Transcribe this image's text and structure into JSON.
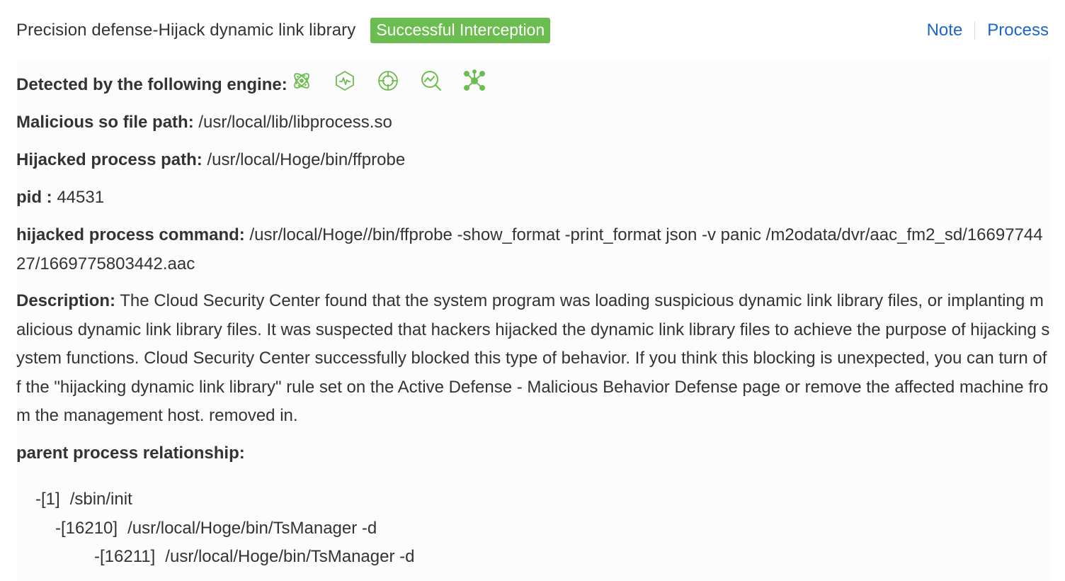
{
  "header": {
    "title": "Precision defense-Hijack dynamic link library",
    "status_badge": "Successful Interception",
    "status_color": "#6bbd4f",
    "actions": {
      "note": "Note",
      "process": "Process"
    }
  },
  "details": {
    "engine_label": "Detected by the following engine:",
    "engine_icons": [
      "atom-engine-icon",
      "hexagon-pulse-engine-icon",
      "crosshair-engine-icon",
      "magnify-trend-engine-icon",
      "network-engine-icon"
    ],
    "malicious_so_label": "Malicious so file path:",
    "malicious_so_value": "/usr/local/lib/libprocess.so",
    "hijacked_path_label": "Hijacked process path:",
    "hijacked_path_value": "/usr/local/Hoge/bin/ffprobe",
    "pid_label": "pid :",
    "pid_value": "44531",
    "command_label": "hijacked process command:",
    "command_value": "/usr/local/Hoge//bin/ffprobe -show_format -print_format json -v panic /m2odata/dvr/aac_fm2_sd/1669774427/1669775803442.aac",
    "description_label": "Description:",
    "description_value": "The Cloud Security Center found that the system program was loading suspicious dynamic link library files, or implanting malicious dynamic link library files. It was suspected that hackers hijacked the dynamic link library files to achieve the purpose of hijacking system functions. Cloud Security Center successfully blocked this type of behavior. If you think this blocking is unexpected, you can turn off the \"hijacking dynamic link library\" rule set on the Active Defense - Malicious Behavior Defense page or remove the affected machine from the management host. removed in.",
    "parent_label": "parent process relationship:"
  },
  "process_tree": [
    {
      "pid": "-[1]",
      "path": "/sbin/init"
    },
    {
      "pid": "-[16210]",
      "path": "/usr/local/Hoge/bin/TsManager -d"
    },
    {
      "pid": "-[16211]",
      "path": "/usr/local/Hoge/bin/TsManager -d"
    }
  ],
  "colors": {
    "accent_link": "#1a66c9",
    "engine_icon": "#6bbd4f",
    "text": "#333333"
  }
}
